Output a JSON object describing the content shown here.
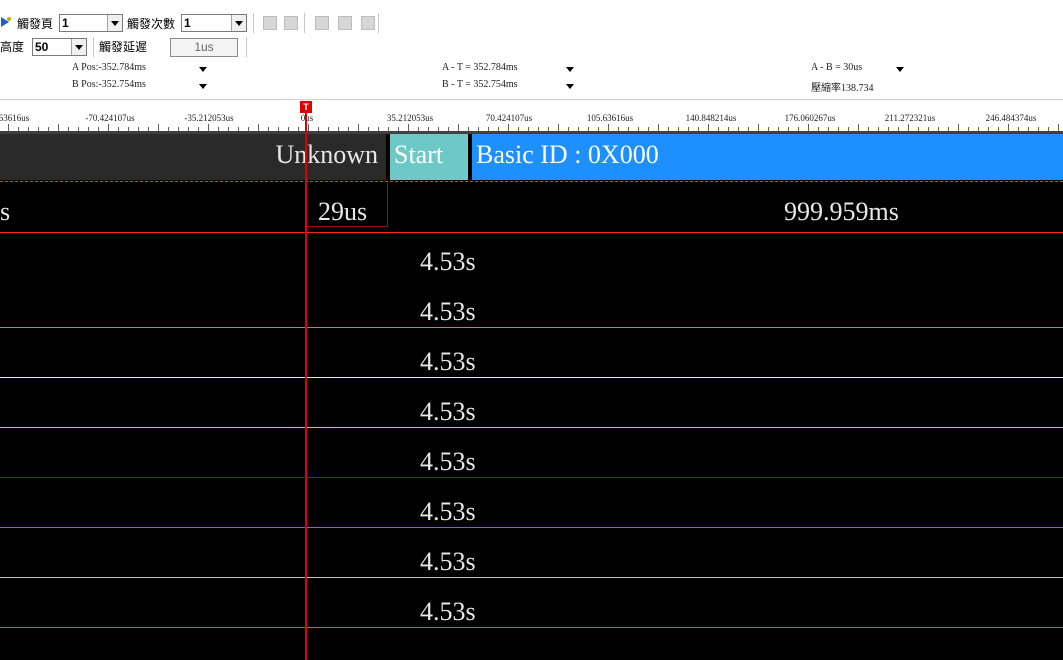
{
  "toolbar": {
    "trigger_page_label": "觸發頁",
    "trigger_page_value": "1",
    "trigger_count_label": "觸發次數",
    "trigger_count_value": "1",
    "height_label": "高度",
    "height_value": "50",
    "trigger_delay_label": "觸發延遲",
    "trigger_delay_value": "1us"
  },
  "info": {
    "a_pos": "A Pos:-352.784ms",
    "b_pos": "B Pos:-352.754ms",
    "a_t": "A - T = 352.784ms",
    "b_t": "B - T = 352.754ms",
    "a_b": "A - B = 30us",
    "compression": "壓縮率138.734"
  },
  "ruler": {
    "ticks": [
      "63616us",
      "-70.424107us",
      "-35.212053us",
      "0us",
      "35.212053us",
      "70.424107us",
      "105.63616us",
      "140.848214us",
      "176.060267us",
      "211.272321us",
      "246.484374us"
    ],
    "marker_label": "T"
  },
  "protocol": {
    "unknown": "Unknown",
    "start": "Start",
    "basic_id": "Basic ID : 0X000"
  },
  "timing_row": {
    "left": "s",
    "mid": "29us",
    "right": "999.959ms"
  },
  "channels": [
    "4.53s",
    "4.53s",
    "4.53s",
    "4.53s",
    "4.53s",
    "4.53s",
    "4.53s",
    "4.53s"
  ],
  "channel_colors": [
    "#000000",
    "#ff6060",
    "#e6ff80",
    "#80e080",
    "#2020ff",
    "#c040c0",
    "#c0c0c0",
    "#ff4040"
  ]
}
